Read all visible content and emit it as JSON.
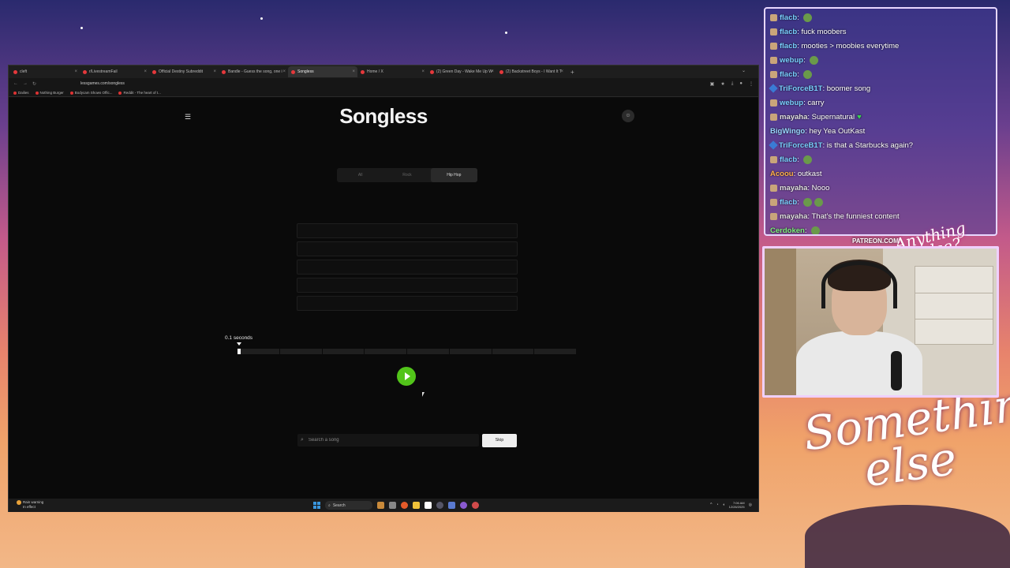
{
  "browser": {
    "tabs": [
      {
        "label": "cleft",
        "active": false
      },
      {
        "label": "r/LivestreamFail",
        "active": false
      },
      {
        "label": "Official Destiny Subreddit",
        "active": false
      },
      {
        "label": "Bandle - Guess the song, one i",
        "active": false
      },
      {
        "label": "Songless",
        "active": true
      },
      {
        "label": "Home / X",
        "active": false
      },
      {
        "label": "(2) Green Day - Wake Me Up W",
        "active": false
      },
      {
        "label": "(2) Backstreet Boys - I Want It T",
        "active": false
      }
    ],
    "url": "lessgames.com/songless",
    "bookmarks": [
      "Dailies",
      "Nothing Burger",
      "Bodycam Shows Offic...",
      "Reddit - The heart of t..."
    ]
  },
  "songless": {
    "logo": "Songless",
    "genres": [
      {
        "label": "All",
        "active": false
      },
      {
        "label": "Rock",
        "active": false
      },
      {
        "label": "Hip Hop",
        "active": true
      }
    ],
    "guess_slots": 5,
    "seconds_label": "0.1 seconds",
    "progress_fraction": 0.01,
    "segments": 8,
    "search_placeholder": "Search a song",
    "skip_label": "Skip",
    "play_color": "#52c41a"
  },
  "taskbar": {
    "weather_line1": "Rain warning",
    "weather_line2": "In effect",
    "search_label": "Search",
    "time": "7:06 AM",
    "date": "12/28/2025"
  },
  "chat": [
    {
      "user": "flacb",
      "color": "#7ad0ff",
      "text": "",
      "badge": "badge",
      "emotes": 1
    },
    {
      "user": "flacb",
      "color": "#7ad0ff",
      "text": "fuck moobers",
      "badge": "badge",
      "emotes": 0
    },
    {
      "user": "flacb",
      "color": "#7ad0ff",
      "text": "mooties > moobies everytime",
      "badge": "badge",
      "emotes": 0
    },
    {
      "user": "webup",
      "color": "#7ad0ff",
      "text": "",
      "badge": "badge",
      "emotes": 1
    },
    {
      "user": "flacb",
      "color": "#7ad0ff",
      "text": "",
      "badge": "badge",
      "emotes": 1
    },
    {
      "user": "TriForceB1T",
      "color": "#7ad0ff",
      "text": "boomer song",
      "badge": "badge2",
      "emotes": 0
    },
    {
      "user": "webup",
      "color": "#7ad0ff",
      "text": "carry",
      "badge": "badge",
      "emotes": 0
    },
    {
      "user": "mayaha",
      "color": "#e0e0e0",
      "text": "Supernatural",
      "badge": "badge",
      "emotes": 0,
      "heart": true
    },
    {
      "user": "BigWingo",
      "color": "#9ad7ff",
      "text": "hey Yea OutKast",
      "badge": "",
      "emotes": 0
    },
    {
      "user": "TriForceB1T",
      "color": "#7ad0ff",
      "text": "is that a Starbucks again?",
      "badge": "badge2",
      "emotes": 0
    },
    {
      "user": "flacb",
      "color": "#7ad0ff",
      "text": "",
      "badge": "badge",
      "emotes": 1
    },
    {
      "user": "Acoou",
      "color": "#ffb04a",
      "text": "outkast",
      "badge": "",
      "emotes": 0
    },
    {
      "user": "mayaha",
      "color": "#e0e0e0",
      "text": "Nooo",
      "badge": "badge",
      "emotes": 0
    },
    {
      "user": "flacb",
      "color": "#7ad0ff",
      "text": "",
      "badge": "badge",
      "emotes": 2
    },
    {
      "user": "mayaha",
      "color": "#e0e0e0",
      "text": "That's the funniest content",
      "badge": "badge",
      "emotes": 0
    },
    {
      "user": "Cerdoken",
      "color": "#7cf07c",
      "text": "",
      "badge": "",
      "emotes": 1
    }
  ],
  "overlay": {
    "patreon_label": "PATREON.COM/",
    "cam_logo_line1": "Anything",
    "cam_logo_line2": "else?",
    "brand_line1": "Something",
    "brand_line2": "else"
  }
}
